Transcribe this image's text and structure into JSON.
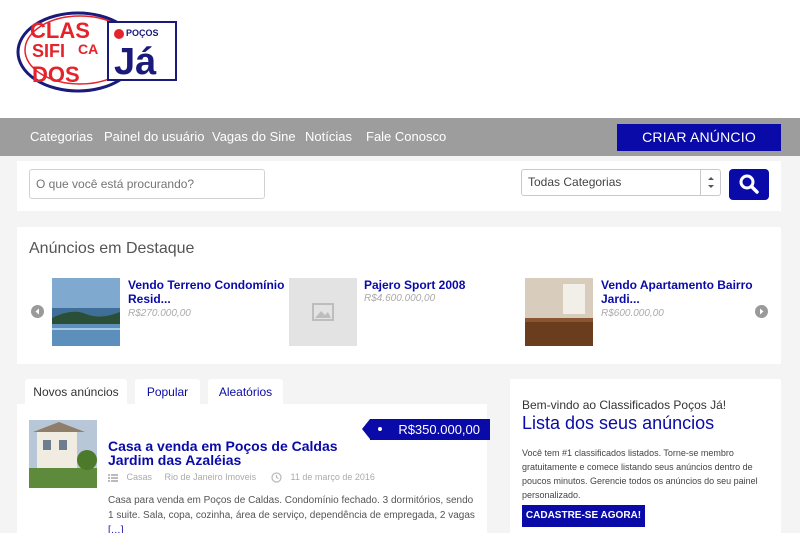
{
  "logo": {
    "text_lines": [
      "CLAS",
      "SIFI",
      "CA",
      "DOS"
    ],
    "brand_small": "POÇOS",
    "brand_big": "Já"
  },
  "nav": {
    "items": [
      "Categorias",
      "Painel do usuário",
      "Vagas do Sine",
      "Notícias",
      "Fale Conosco"
    ],
    "cta_label": "CRIAR ANÚNCIO"
  },
  "search": {
    "placeholder": "O que você está procurando?",
    "category_value": "Todas Categorias"
  },
  "featured": {
    "title": "Anúncios em Destaque",
    "cards": [
      {
        "title_line1": "Vendo Terreno Condomínio",
        "title_line2": "Resid...",
        "price": "R$270.000,00",
        "image": "lake-photo"
      },
      {
        "title_line1": "Pajero Sport 2008",
        "title_line2": "",
        "price": "R$4.600.000,00",
        "image": "placeholder-image-icon"
      },
      {
        "title_line1": "Vendo Apartamento Bairro",
        "title_line2": "Jardi...",
        "price": "R$600.000,00",
        "image": "room-photo"
      }
    ]
  },
  "tabs": [
    "Novos anúncios",
    "Popular",
    "Aleatórios"
  ],
  "listing": {
    "price": "R$350.000,00",
    "title": "Casa a venda em Poços de Caldas Jardim das Azaléias",
    "category": "Casas",
    "location": "Rio de Janeiro Imoveis",
    "date": "11 de março de 2016",
    "description": "Casa para venda em Poços de Caldas. Condomínio fechado. 3 dormitórios, sendo 1 suite. Sala, copa, cozinha, área de serviço, dependência de empregada, 2 vagas",
    "more": "[…]"
  },
  "sidebar": {
    "welcome": "Bem-vindo ao Classificados Poços Já!",
    "title": "Lista dos seus anúncios",
    "text": "Você tem #1 classificados listados. Torne-se membro gratuitamente e comece listando seus anúncios dentro de poucos minutos. Gerencie todos os anúncios do seu painel personalizado.",
    "button": "CADASTRE-SE AGORA!"
  },
  "colors": {
    "brand_blue": "#0a0aa8",
    "logo_red": "#e4232b",
    "nav_gray": "#9d9d9d"
  }
}
